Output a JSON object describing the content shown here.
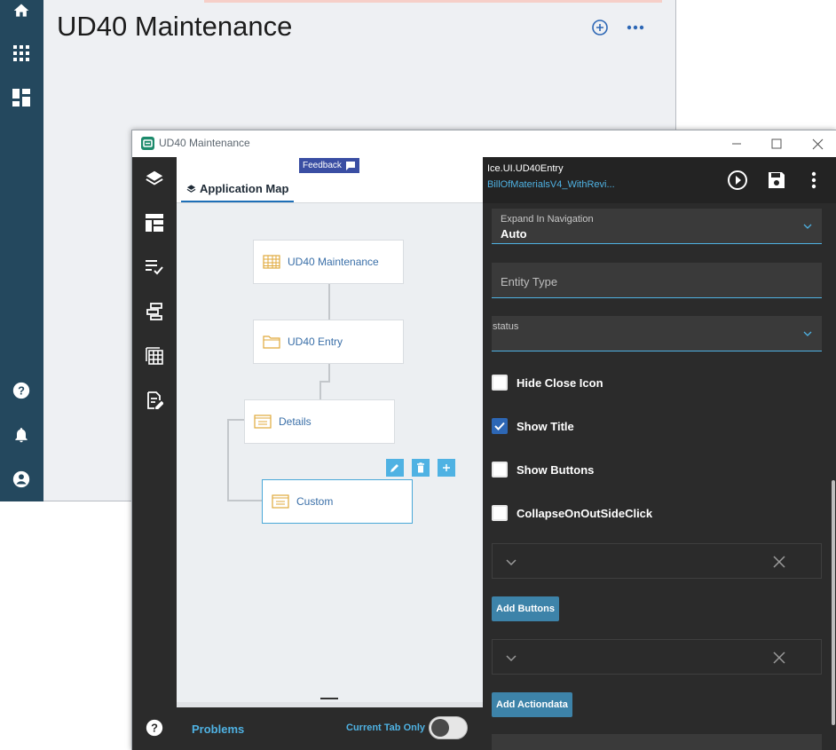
{
  "background_app": {
    "title": "UD40 Maintenance",
    "nav_icons": [
      "home-icon",
      "apps-grid-icon",
      "dashboard-icon",
      "help-icon",
      "notifications-icon",
      "account-icon"
    ],
    "actions": [
      "add-circle-icon",
      "more-horizontal-icon"
    ]
  },
  "window": {
    "title": "UD40 Maintenance",
    "controls": [
      "minimize-icon",
      "maximize-icon",
      "close-icon"
    ]
  },
  "left_rail": {
    "icons": [
      "layers-icon",
      "layout-icon",
      "checklist-icon",
      "dataflow-icon",
      "grid-table-icon",
      "edit-document-icon",
      "help-icon"
    ]
  },
  "map": {
    "feedback_label": "Feedback",
    "tab_label": "Application Map",
    "nodes": [
      {
        "label": "UD40 Maintenance",
        "icon": "table-icon"
      },
      {
        "label": "UD40 Entry",
        "icon": "folder-icon"
      },
      {
        "label": "Details",
        "icon": "panel-icon"
      },
      {
        "label": "Custom",
        "icon": "panel-icon"
      }
    ],
    "node_actions": [
      "edit-icon",
      "delete-icon",
      "add-icon"
    ]
  },
  "problems": {
    "label": "Problems",
    "current_tab_only_label": "Current Tab Only",
    "current_tab_only": false
  },
  "props": {
    "component_id": "Ice.UI.UD40Entry",
    "layer_link": "BillOfMaterialsV4_WithRevi...",
    "header_icons": [
      "run-icon",
      "save-icon",
      "more-vertical-icon"
    ],
    "expand_in_navigation": {
      "label": "Expand In Navigation",
      "value": "Auto"
    },
    "entity_type": {
      "placeholder": "Entity Type"
    },
    "status": {
      "label": "status",
      "value": ""
    },
    "checkboxes": [
      {
        "label": "Hide Close Icon",
        "checked": false
      },
      {
        "label": "Show Title",
        "checked": true
      },
      {
        "label": "Show Buttons",
        "checked": false
      },
      {
        "label": "CollapseOnOutSideClick",
        "checked": false
      }
    ],
    "add_buttons_label": "Add Buttons",
    "add_actiondata_label": "Add Actiondata"
  }
}
